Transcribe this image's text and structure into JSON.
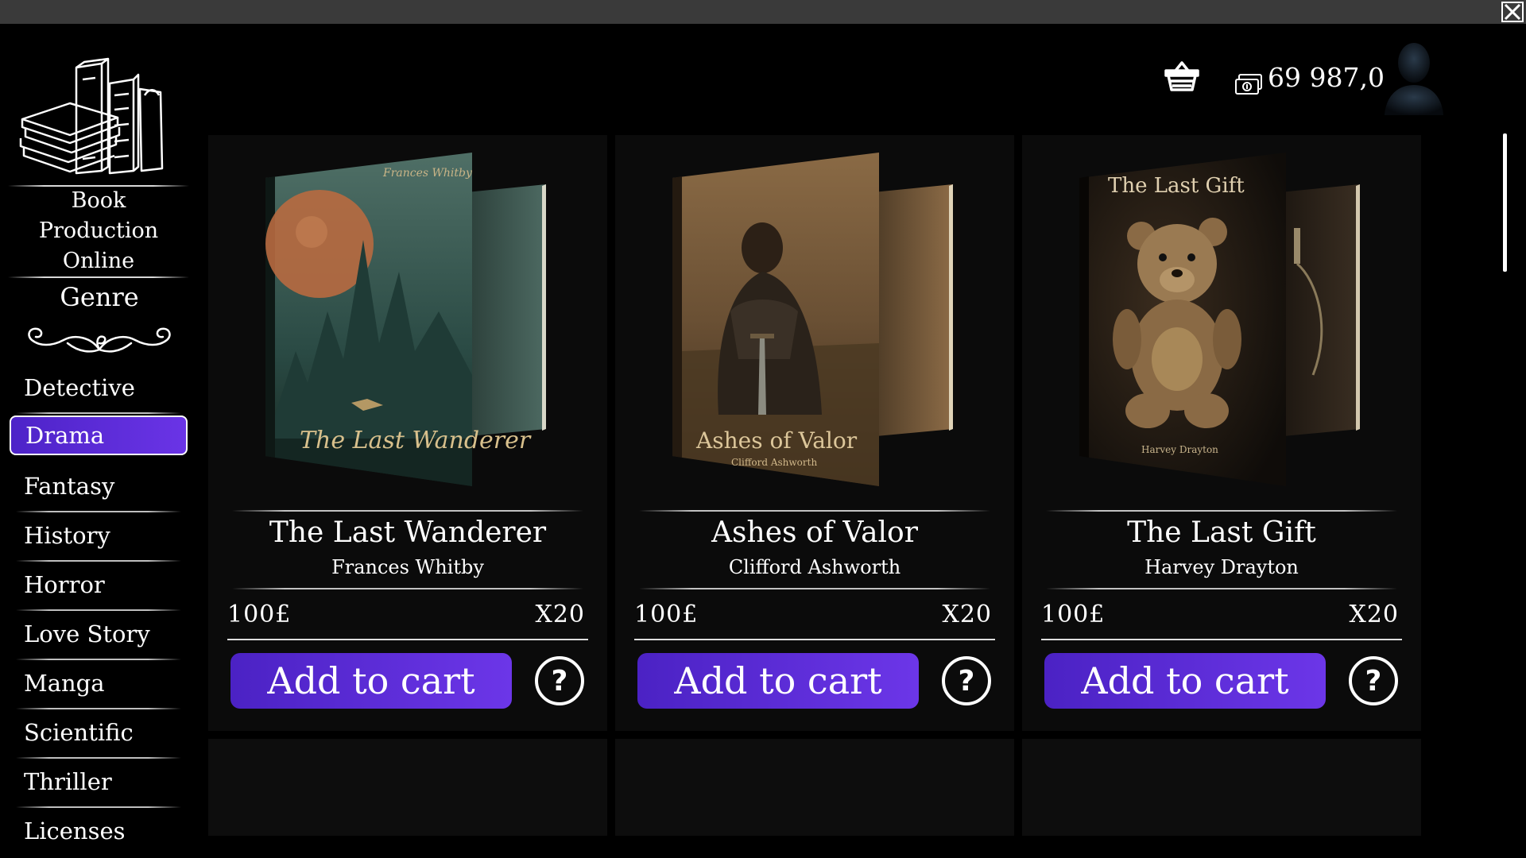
{
  "window": {
    "close_icon": "close-icon"
  },
  "brand": {
    "title": "Book Production Online",
    "logo_icon": "books-stack-icon"
  },
  "sidebar": {
    "heading": "Genre",
    "items": [
      {
        "label": "Detective",
        "active": false
      },
      {
        "label": "Drama",
        "active": true
      },
      {
        "label": "Fantasy",
        "active": false
      },
      {
        "label": "History",
        "active": false
      },
      {
        "label": "Horror",
        "active": false
      },
      {
        "label": "Love Story",
        "active": false
      },
      {
        "label": "Manga",
        "active": false
      },
      {
        "label": "Scientific",
        "active": false
      },
      {
        "label": "Thriller",
        "active": false
      },
      {
        "label": "Licenses",
        "active": false
      }
    ]
  },
  "header": {
    "cart_icon": "basket-icon",
    "money_icon": "banknote-icon",
    "money": "69 987,0",
    "avatar_icon": "user-silhouette-icon"
  },
  "books": [
    {
      "title": "The Last Wanderer",
      "author": "Frances Whitby",
      "price": "100£",
      "quantity": "X20",
      "cover": {
        "title": "The Last Wanderer",
        "author": "Frances Whitby",
        "palette": [
          "#2f5a54",
          "#c07044",
          "#1c3a36"
        ]
      },
      "button": "Add to cart",
      "help": "?"
    },
    {
      "title": "Ashes of Valor",
      "author": "Clifford Ashworth",
      "price": "100£",
      "quantity": "X20",
      "cover": {
        "title": "Ashes of Valor",
        "author": "Clifford Ashworth",
        "palette": [
          "#6b5435",
          "#c9a066",
          "#2e2318"
        ]
      },
      "button": "Add to cart",
      "help": "?"
    },
    {
      "title": "The Last Gift",
      "author": "Harvey Drayton",
      "price": "100£",
      "quantity": "X20",
      "cover": {
        "title": "The Last Gift",
        "author": "Harvey Drayton",
        "palette": [
          "#1f1a15",
          "#8a6a45",
          "#0f0c09"
        ]
      },
      "button": "Add to cart",
      "help": "?"
    }
  ],
  "colors": {
    "accent": "#5a2bd6",
    "accent_light": "#6c36e8",
    "background": "#000000",
    "card": "#0b0b0b",
    "titlebar": "#3a3a3a"
  }
}
